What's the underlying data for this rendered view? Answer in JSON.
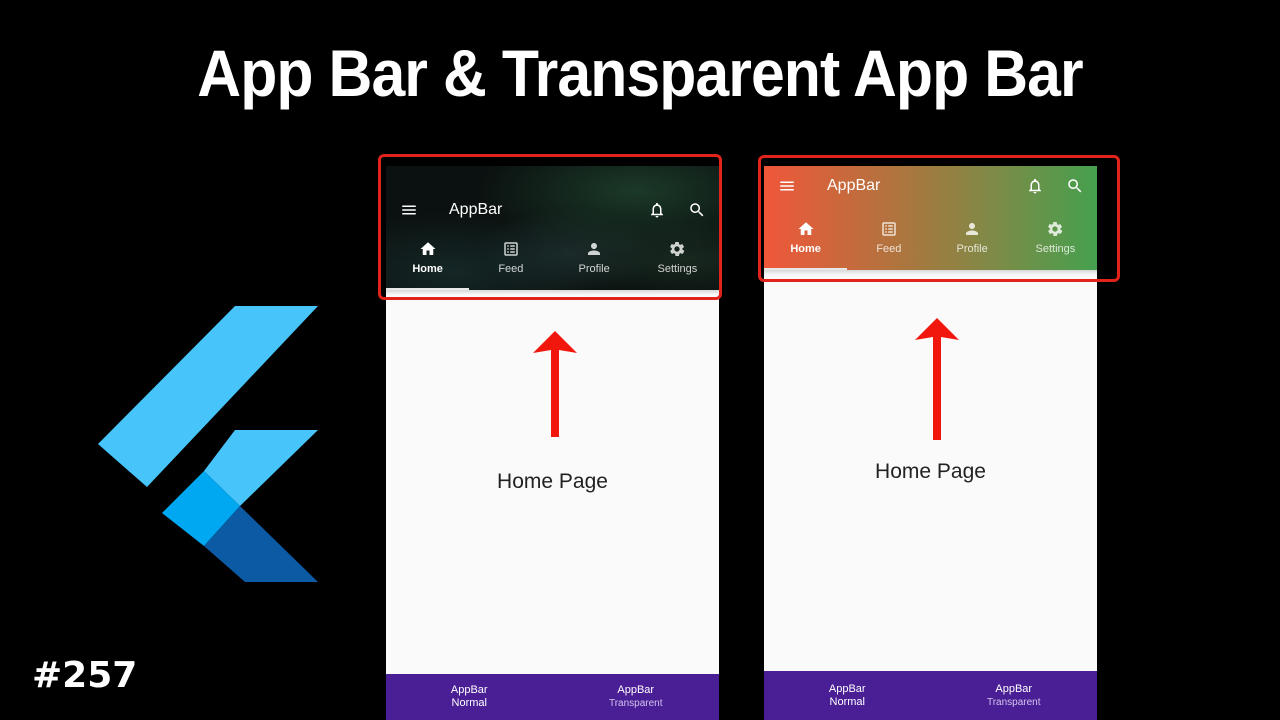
{
  "video": {
    "title": "App Bar & Transparent App Bar",
    "episode": "#257"
  },
  "colors": {
    "highlight": "#e0231b",
    "arrow": "#f2170c",
    "bottom_nav": "#4a1f96",
    "gradient_start": "#f0573a",
    "gradient_end": "#45a04e",
    "flutter_light": "#47c5fb",
    "flutter_mid": "#00a8f2",
    "flutter_dark": "#0b5aa3"
  },
  "screens": [
    {
      "variant": "normal",
      "appbar": {
        "title": "AppBar",
        "actions": [
          "bell-icon",
          "search-icon"
        ],
        "leading": "menu-icon",
        "background": "image"
      },
      "tabs": [
        {
          "label": "Home",
          "icon": "home-icon",
          "active": true
        },
        {
          "label": "Feed",
          "icon": "feed-icon",
          "active": false
        },
        {
          "label": "Profile",
          "icon": "person-icon",
          "active": false
        },
        {
          "label": "Settings",
          "icon": "gear-icon",
          "active": false
        }
      ],
      "body_text": "Home Page",
      "bottom_nav": [
        {
          "line1": "AppBar",
          "line2": "Normal",
          "selected": true
        },
        {
          "line1": "AppBar",
          "line2": "Transparent",
          "selected": false
        }
      ]
    },
    {
      "variant": "transparent",
      "appbar": {
        "title": "AppBar",
        "actions": [
          "bell-icon",
          "search-icon"
        ],
        "leading": "menu-icon",
        "background": "gradient"
      },
      "tabs": [
        {
          "label": "Home",
          "icon": "home-icon",
          "active": true
        },
        {
          "label": "Feed",
          "icon": "feed-icon",
          "active": false
        },
        {
          "label": "Profile",
          "icon": "person-icon",
          "active": false
        },
        {
          "label": "Settings",
          "icon": "gear-icon",
          "active": false
        }
      ],
      "body_text": "Home Page",
      "bottom_nav": [
        {
          "line1": "AppBar",
          "line2": "Normal",
          "selected": true
        },
        {
          "line1": "AppBar",
          "line2": "Transparent",
          "selected": false
        }
      ]
    }
  ]
}
